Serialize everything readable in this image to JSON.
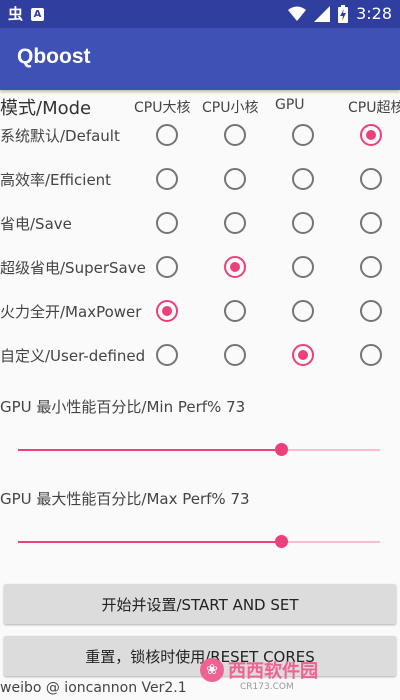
{
  "status": {
    "time": "3:28"
  },
  "app": {
    "title": "Qboost"
  },
  "modes": {
    "header": "模式/Mode",
    "columns": [
      "CPU大核",
      "CPU小核",
      "GPU",
      "CPU超核"
    ],
    "rows": [
      {
        "label": "系统默认/Default",
        "selected": 3
      },
      {
        "label": "高效率/Efficient",
        "selected": -1
      },
      {
        "label": "省电/Save",
        "selected": -1
      },
      {
        "label": "超级省电/SuperSave",
        "selected": 1
      },
      {
        "label": "火力全开/MaxPower",
        "selected": 0
      },
      {
        "label": "自定义/User-defined",
        "selected": 2
      }
    ]
  },
  "sliders": {
    "min": {
      "label": "GPU 最小性能百分比/Min Perf% 73",
      "value": 73
    },
    "max": {
      "label": "GPU 最大性能百分比/Max Perf% 73",
      "value": 73
    }
  },
  "buttons": {
    "start": "开始并设置/START AND SET",
    "reset": "重置，锁核时使用/RESET CORES"
  },
  "footer": {
    "credit": "weibo @ ioncannon Ver2.1"
  },
  "watermark": {
    "text": "西西软件园",
    "sub": "CR173.COM"
  },
  "colors": {
    "primary": "#3f51b5",
    "primary_dark": "#303f9f",
    "accent": "#ec407a"
  }
}
